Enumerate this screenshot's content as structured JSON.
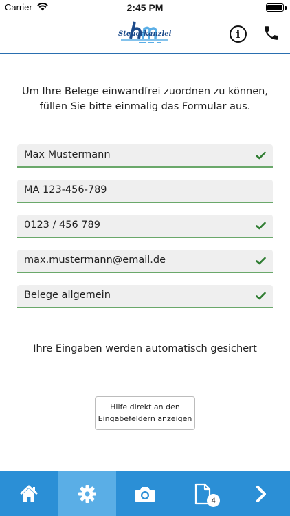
{
  "status_bar": {
    "carrier": "Carrier",
    "time": "2:45 PM"
  },
  "header": {
    "logo_text": "Steuerkanzlei",
    "icons": [
      "info-icon",
      "phone-icon"
    ]
  },
  "intro": {
    "text": "Um Ihre Belege einwandfrei zuordnen zu können, füllen Sie bitte einmalig das Formular aus."
  },
  "form": {
    "fields": [
      {
        "value": "Max Mustermann",
        "valid": true
      },
      {
        "value": "MA 123-456-789",
        "valid": false
      },
      {
        "value": "0123 / 456 789",
        "valid": true
      },
      {
        "value": "max.mustermann@email.de",
        "valid": true
      },
      {
        "value": "Belege allgemein",
        "valid": true
      }
    ]
  },
  "autosave_text": "Ihre Eingaben werden automatisch gesichert",
  "help_button": {
    "label": "Hilfe direkt an den Eingabefeldern anzeigen"
  },
  "tabbar": {
    "tabs": [
      {
        "icon": "home-icon",
        "active": false
      },
      {
        "icon": "gear-icon",
        "active": true
      },
      {
        "icon": "camera-icon",
        "active": false
      },
      {
        "icon": "document-icon",
        "active": false,
        "badge": "4"
      },
      {
        "icon": "chevron-right-icon",
        "active": false
      }
    ]
  },
  "colors": {
    "tabbar": "#2b8fd6",
    "tab_active": "#5aaee6",
    "check_green": "#2f7d32",
    "field_underline": "#6aa86a",
    "header_line": "#2a6fb0"
  }
}
